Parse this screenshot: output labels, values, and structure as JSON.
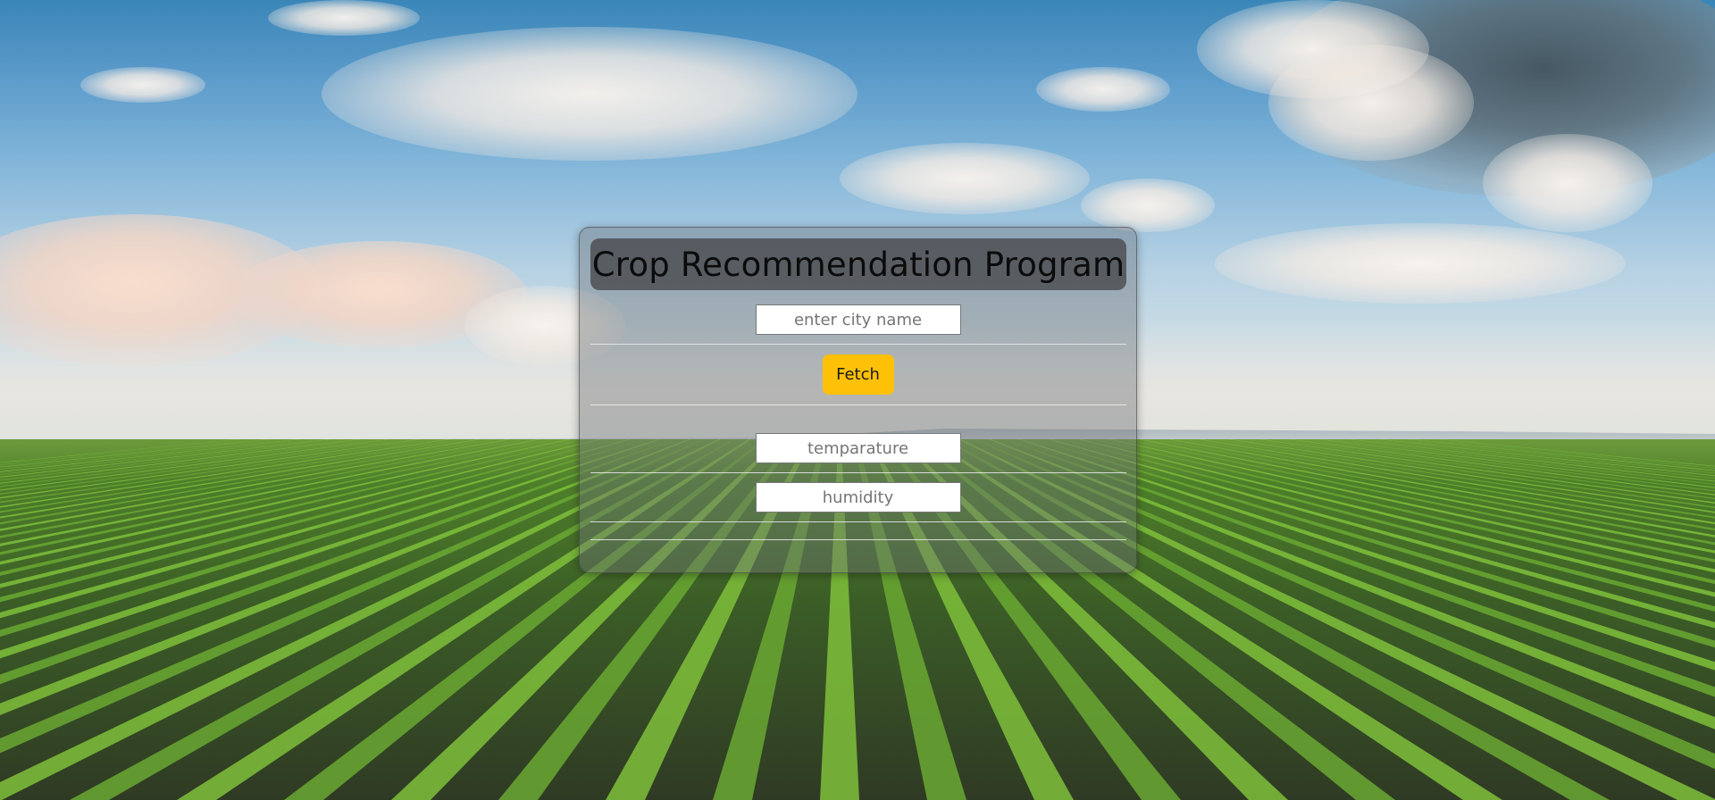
{
  "app": {
    "title": "Crop Recommendation Program"
  },
  "form": {
    "city_placeholder": "enter city name",
    "city_value": "",
    "fetch_label": "Fetch",
    "temperature_placeholder": "temparature",
    "temperature_value": "",
    "humidity_placeholder": "humidity",
    "humidity_value": ""
  },
  "colors": {
    "fetch_button": "#ffc107",
    "title_band": "#46484a",
    "card_overlay": "#6e7376"
  },
  "background": {
    "description_icon": "farm-field-background"
  }
}
